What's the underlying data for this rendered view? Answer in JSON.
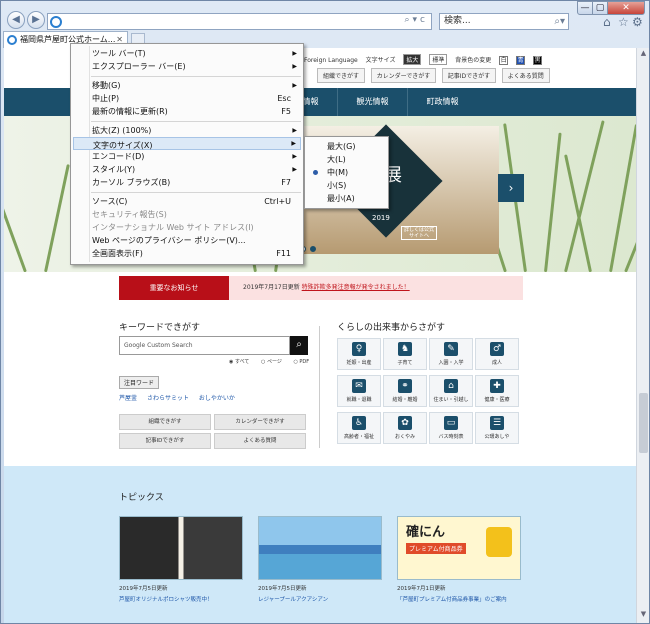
{
  "browser": {
    "address_url": "",
    "search_placeholder": "検索...",
    "tab_title": "福岡県芦屋町公式ホーム...",
    "win_min": "—",
    "win_max": "▢",
    "win_close": "✕"
  },
  "site": {
    "util": {
      "fonts_link": "Foreign Language",
      "text_size_label": "文字サイズ",
      "size_big": "拡大",
      "size_std": "標準",
      "bg_label": "背景色の変更",
      "colors": [
        "白",
        "青",
        "黒"
      ]
    },
    "head_links": [
      "組織できがす",
      "カレンダーできがす",
      "記事IDできがす",
      "よくある質問"
    ],
    "nav": [
      "どの情報",
      "観光情報",
      "町政情報"
    ],
    "hero": {
      "title": "ヤ展",
      "year": "2019",
      "more": "詳しくは公式サイトへ"
    },
    "notice": {
      "label": "重要なお知らせ",
      "date": "2019年7月17日更新",
      "text": "特殊詐欺多発注意報が発令されました！"
    },
    "keyword": {
      "title": "キーワードできがす",
      "placeholder": "Google Custom Search",
      "radios": [
        "すべて",
        "ページ",
        "PDF"
      ],
      "chumoku": "注目ワード",
      "tags": [
        "芦屋釜",
        "さわらサミット",
        "おしやかいか"
      ],
      "quick": [
        "組織できがす",
        "カレンダーできがす",
        "記事IDできがす",
        "よくある質問"
      ]
    },
    "life": {
      "title": "くらしの出来事からさがす",
      "items": [
        "妊娠・出産",
        "子育て",
        "入園・入学",
        "成人",
        "就職・退職",
        "結婚・離婚",
        "住まい・引越し",
        "健康・医療",
        "高齢者・福祉",
        "おくやみ",
        "バス時刻表",
        "公環あしや"
      ]
    },
    "topics": {
      "title": "トピックス",
      "cards": [
        {
          "date": "2019年7月5日更新",
          "title": "芦屋町オリジナルポロシャツ販売中！"
        },
        {
          "date": "2019年7月5日更新",
          "title": "レジャープールアクアシアン"
        },
        {
          "date": "2019年7月1日更新",
          "title": "「芦屋町プレミアム付商品券事業」のご案内"
        }
      ],
      "card3_banner_1": "確にん",
      "card3_banner_2": "プレミアム付商品券"
    }
  },
  "context_menu": {
    "items": [
      {
        "label": "ツール バー(T)",
        "shortcut": "",
        "submenu": true
      },
      {
        "label": "エクスプローラー バー(E)",
        "shortcut": "",
        "submenu": true
      },
      {
        "label": "移動(G)",
        "shortcut": "",
        "submenu": true
      },
      {
        "label": "中止(P)",
        "shortcut": "Esc",
        "submenu": false
      },
      {
        "label": "最新の情報に更新(R)",
        "shortcut": "F5",
        "submenu": false
      },
      {
        "label": "拡大(Z) (100%)",
        "shortcut": "",
        "submenu": true
      },
      {
        "label": "文字のサイズ(X)",
        "shortcut": "",
        "submenu": true
      },
      {
        "label": "エンコード(D)",
        "shortcut": "",
        "submenu": true
      },
      {
        "label": "スタイル(Y)",
        "shortcut": "",
        "submenu": true
      },
      {
        "label": "カーソル ブラウズ(B)",
        "shortcut": "F7",
        "submenu": false
      },
      {
        "label": "ソース(C)",
        "shortcut": "Ctrl+U",
        "submenu": false
      },
      {
        "label": "セキュリティ報告(S)",
        "shortcut": "",
        "submenu": false
      },
      {
        "label": "インターナショナル Web サイト アドレス(I)",
        "shortcut": "",
        "submenu": false
      },
      {
        "label": "Web ページのプライバシー ポリシー(V)...",
        "shortcut": "",
        "submenu": false
      },
      {
        "label": "全画面表示(F)",
        "shortcut": "F11",
        "submenu": false
      }
    ]
  },
  "text_size_menu": {
    "items": [
      "最大(G)",
      "大(L)",
      "中(M)",
      "小(S)",
      "最小(A)"
    ],
    "selected": "中(M)"
  }
}
